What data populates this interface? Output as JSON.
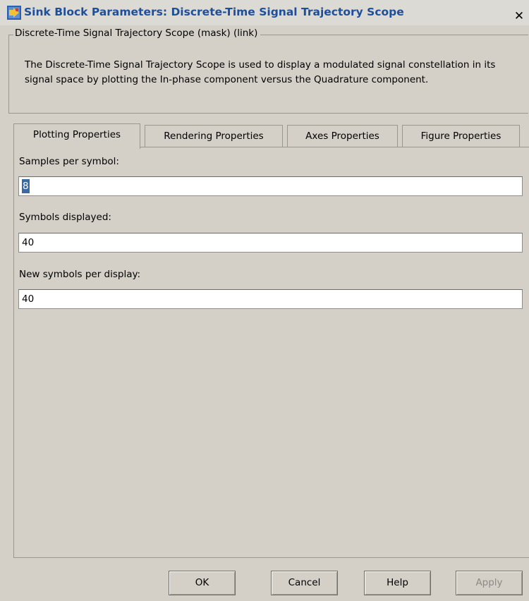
{
  "window": {
    "title": "Sink Block Parameters: Discrete-Time Signal Trajectory Scope",
    "close_glyph": "✕"
  },
  "mask": {
    "group_title": "Discrete-Time Signal Trajectory Scope (mask) (link)",
    "description": "The Discrete-Time Signal Trajectory Scope is used to display a modulated signal constellation in its signal space by plotting the In-phase component versus the Quadrature component."
  },
  "tabs": [
    {
      "label": "Plotting Properties",
      "active": true
    },
    {
      "label": "Rendering Properties",
      "active": false
    },
    {
      "label": "Axes Properties",
      "active": false
    },
    {
      "label": "Figure Properties",
      "active": false
    }
  ],
  "fields": {
    "samples_per_symbol": {
      "label": "Samples per symbol:",
      "value": "8"
    },
    "symbols_displayed": {
      "label": "Symbols displayed:",
      "value": "40"
    },
    "new_symbols_per_display": {
      "label": "New symbols per display:",
      "value": "40"
    }
  },
  "buttons": {
    "ok": "OK",
    "cancel": "Cancel",
    "help": "Help",
    "apply": "Apply"
  },
  "colors": {
    "title_text": "#1e4f9b",
    "background": "#d4d0c8",
    "selection": "#3a6aa6"
  },
  "icons": {
    "app": "simulink-block-icon",
    "close": "close-icon"
  }
}
